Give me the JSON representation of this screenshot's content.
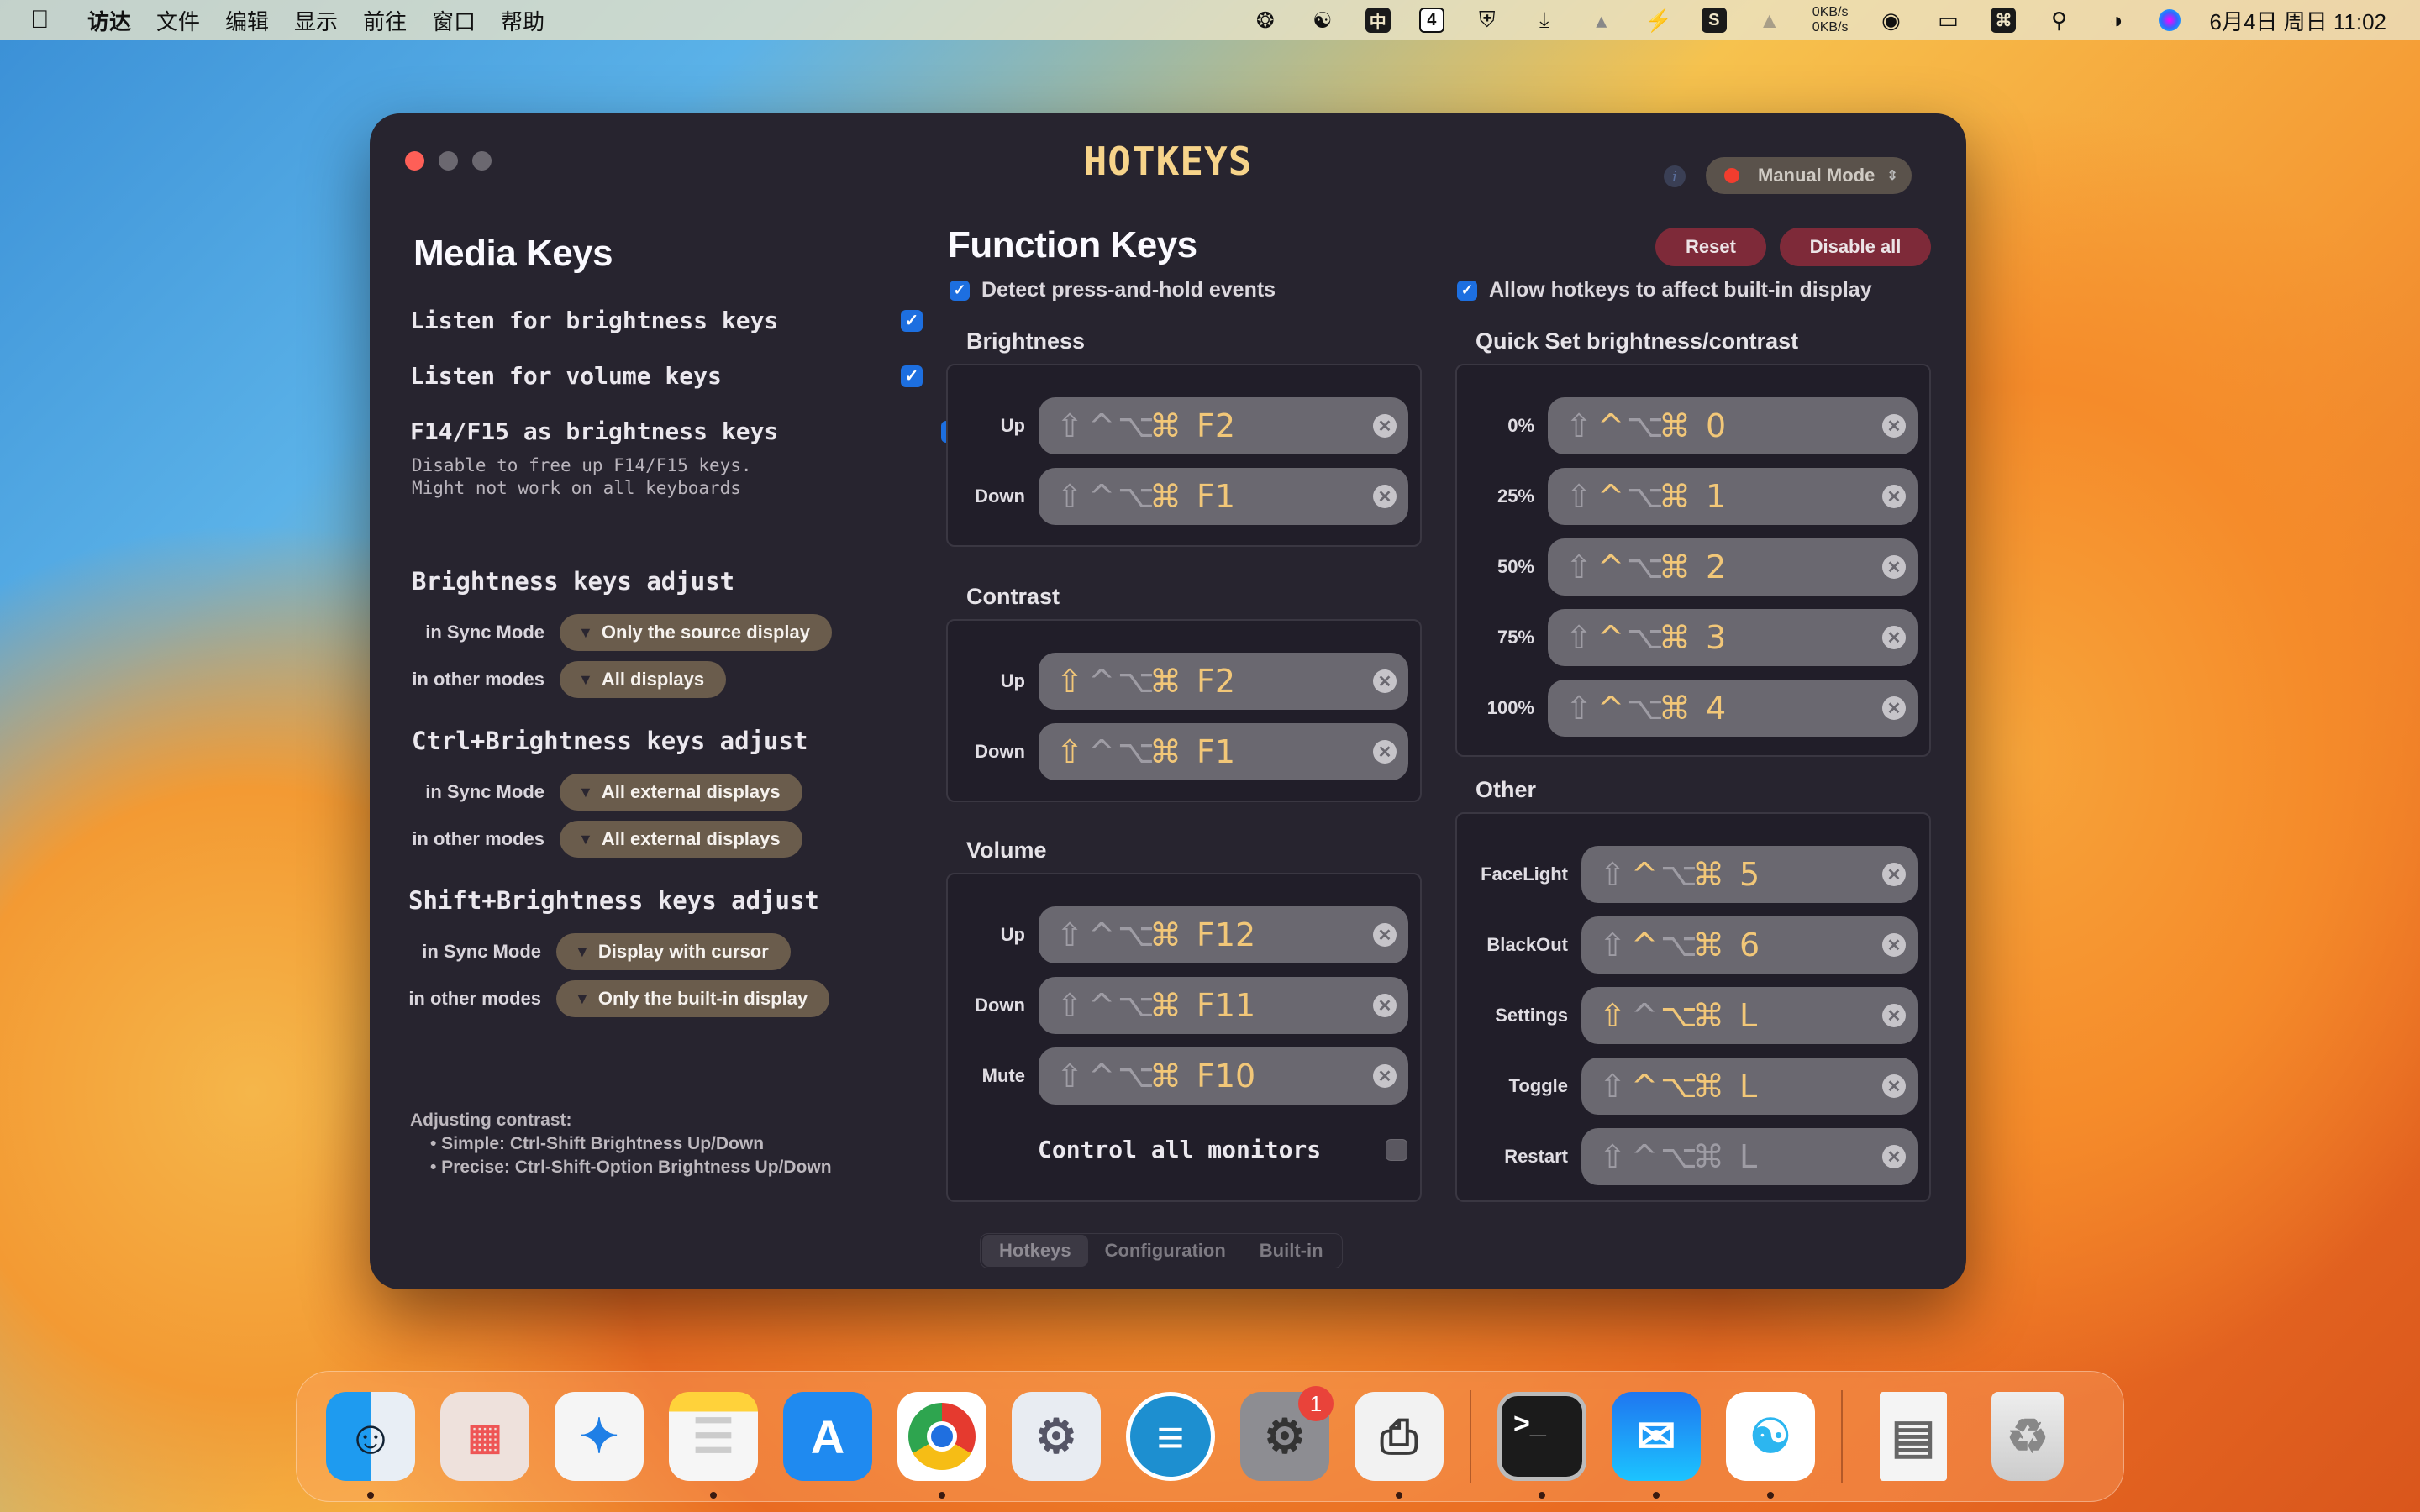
{
  "menubar": {
    "apple_icon": "apple-logo",
    "items": [
      "访达",
      "文件",
      "编辑",
      "显示",
      "前往",
      "窗口",
      "帮助"
    ],
    "status_icons": [
      "film-reel-icon",
      "baidu-cloud-icon",
      "input-method-zhong-icon",
      "badge-4-icon",
      "shield-exclamation-icon",
      "download-tray-icon",
      "broom-icon",
      "battery-charging-icon",
      "s-app-icon",
      "cat-icon"
    ],
    "net_up": "0KB/s",
    "net_down": "0KB/s",
    "right_icons": [
      "wifi-icon",
      "display-icon",
      "command-icon",
      "search-icon",
      "control-center-icon",
      "siri-icon"
    ],
    "clock": "6月4日 周日  11:02"
  },
  "window": {
    "title": "HOTKEYS",
    "info_icon": "i",
    "mode_select": {
      "value": "Manual Mode",
      "dot_color": "#f23d2e"
    },
    "reset_label": "Reset",
    "disable_all_label": "Disable all"
  },
  "media_keys": {
    "title": "Media Keys",
    "checks": [
      {
        "label": "Listen for brightness keys",
        "checked": true
      },
      {
        "label": "Listen for volume keys",
        "checked": true
      },
      {
        "label": "F14/F15 as brightness keys",
        "checked": true
      }
    ],
    "f14_note_1": "Disable to free up F14/F15 keys.",
    "f14_note_2": "Might not work on all keyboards",
    "sections": [
      {
        "title": "Brightness keys adjust",
        "sync_label": "in Sync Mode",
        "sync_value": "Only the source display",
        "other_label": "in other modes",
        "other_value": "All displays"
      },
      {
        "title": "Ctrl+Brightness keys adjust",
        "sync_label": "in Sync Mode",
        "sync_value": "All external displays",
        "other_label": "in other modes",
        "other_value": "All external displays"
      },
      {
        "title": "Shift+Brightness keys adjust",
        "sync_label": "in Sync Mode",
        "sync_value": "Display with cursor",
        "other_label": "in other modes",
        "other_value": "Only the built-in display"
      }
    ],
    "help_title": "Adjusting contrast:",
    "help_1": "• Simple:  Ctrl-Shift Brightness Up/Down",
    "help_2": "• Precise: Ctrl-Shift-Option Brightness Up/Down"
  },
  "function_keys": {
    "title": "Function Keys",
    "detect_hold": {
      "label": "Detect press-and-hold events",
      "checked": true
    },
    "allow_builtin": {
      "label": "Allow hotkeys to affect built-in display",
      "checked": true
    },
    "modifier_glyphs": [
      "⇧",
      "^",
      "⌥",
      "⌘"
    ],
    "brightness": {
      "title": "Brightness",
      "rows": [
        {
          "label": "Up",
          "mods": [
            false,
            false,
            false,
            true
          ],
          "key": "F2",
          "enabled": true
        },
        {
          "label": "Down",
          "mods": [
            false,
            false,
            false,
            true
          ],
          "key": "F1",
          "enabled": true
        }
      ]
    },
    "contrast": {
      "title": "Contrast",
      "rows": [
        {
          "label": "Up",
          "mods": [
            true,
            false,
            false,
            true
          ],
          "key": "F2",
          "enabled": true
        },
        {
          "label": "Down",
          "mods": [
            true,
            false,
            false,
            true
          ],
          "key": "F1",
          "enabled": true
        }
      ]
    },
    "volume": {
      "title": "Volume",
      "rows": [
        {
          "label": "Up",
          "mods": [
            false,
            false,
            false,
            true
          ],
          "key": "F12",
          "enabled": true
        },
        {
          "label": "Down",
          "mods": [
            false,
            false,
            false,
            true
          ],
          "key": "F11",
          "enabled": true
        },
        {
          "label": "Mute",
          "mods": [
            false,
            false,
            false,
            true
          ],
          "key": "F10",
          "enabled": true
        }
      ],
      "control_all_label": "Control all monitors",
      "control_all_checked": false
    },
    "quick_set": {
      "title": "Quick Set brightness/contrast",
      "rows": [
        {
          "label": "0%",
          "mods": [
            false,
            true,
            false,
            true
          ],
          "key": "0",
          "enabled": true
        },
        {
          "label": "25%",
          "mods": [
            false,
            true,
            false,
            true
          ],
          "key": "1",
          "enabled": true
        },
        {
          "label": "50%",
          "mods": [
            false,
            true,
            false,
            true
          ],
          "key": "2",
          "enabled": true
        },
        {
          "label": "75%",
          "mods": [
            false,
            true,
            false,
            true
          ],
          "key": "3",
          "enabled": true
        },
        {
          "label": "100%",
          "mods": [
            false,
            true,
            false,
            true
          ],
          "key": "4",
          "enabled": true
        }
      ]
    },
    "other": {
      "title": "Other",
      "rows": [
        {
          "label": "FaceLight",
          "mods": [
            false,
            true,
            false,
            true
          ],
          "key": "5",
          "enabled": true
        },
        {
          "label": "BlackOut",
          "mods": [
            false,
            true,
            false,
            true
          ],
          "key": "6",
          "enabled": true
        },
        {
          "label": "Settings",
          "mods": [
            true,
            false,
            true,
            true
          ],
          "key": "L",
          "enabled": true
        },
        {
          "label": "Toggle",
          "mods": [
            false,
            true,
            true,
            true
          ],
          "key": "L",
          "enabled": true
        },
        {
          "label": "Restart",
          "mods": [
            false,
            false,
            false,
            false
          ],
          "key": "L",
          "enabled": false
        }
      ]
    }
  },
  "tabs": [
    {
      "label": "Hotkeys",
      "active": true
    },
    {
      "label": "Configuration",
      "active": false
    },
    {
      "label": "Built-in",
      "active": false
    }
  ],
  "dock": {
    "apps": [
      {
        "name": "finder",
        "running": true
      },
      {
        "name": "launchpad",
        "running": false
      },
      {
        "name": "safari",
        "running": false
      },
      {
        "name": "notes",
        "running": true
      },
      {
        "name": "app-store",
        "running": false
      },
      {
        "name": "chrome",
        "running": true
      },
      {
        "name": "automator",
        "running": false
      },
      {
        "name": "lunar-app",
        "running": false
      },
      {
        "name": "system-settings",
        "running": false,
        "badge": "1"
      },
      {
        "name": "disk-utility-printer",
        "running": true
      }
    ],
    "recent": [
      {
        "name": "terminal",
        "running": true
      },
      {
        "name": "mail",
        "running": true
      },
      {
        "name": "baidu-netdisk",
        "running": true
      }
    ],
    "right": [
      {
        "name": "disk-image-document"
      },
      {
        "name": "trash"
      }
    ]
  }
}
